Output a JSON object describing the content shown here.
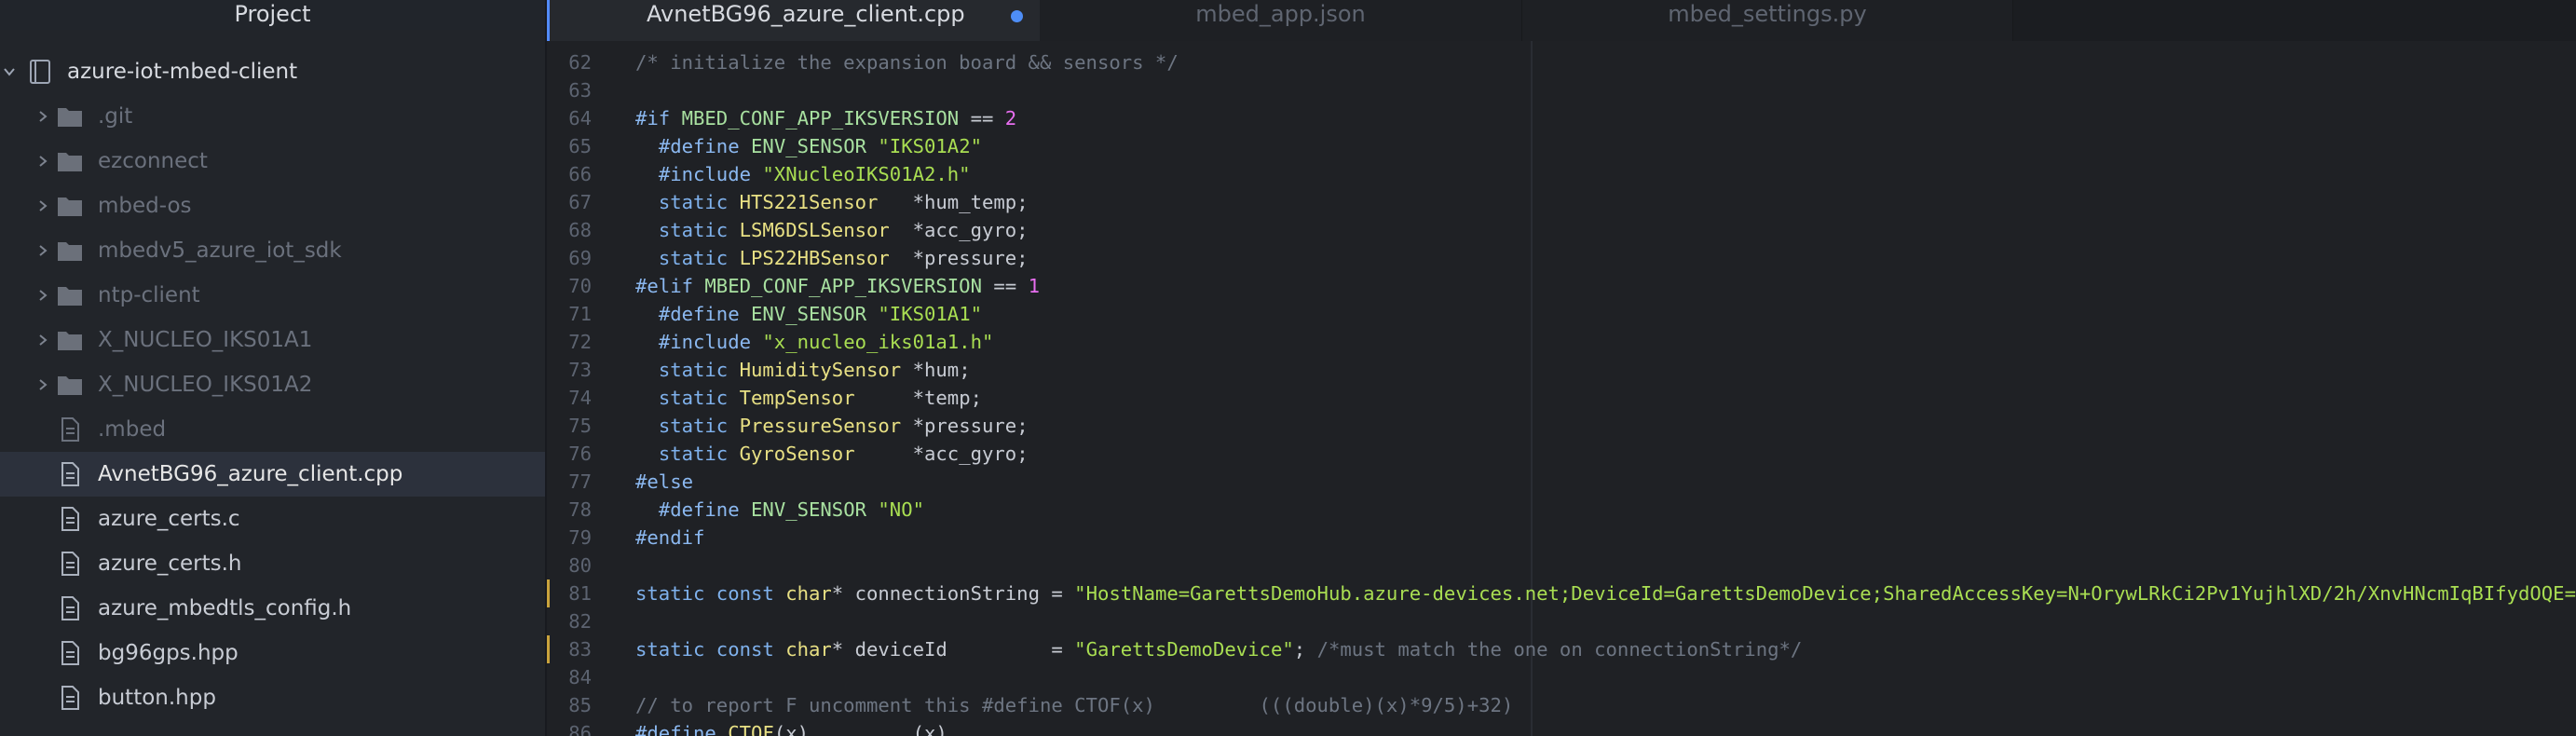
{
  "sidebar": {
    "title": "Project",
    "root": "azure-iot-mbed-client",
    "items": [
      {
        "label": ".git",
        "type": "folder"
      },
      {
        "label": "ezconnect",
        "type": "folder"
      },
      {
        "label": "mbed-os",
        "type": "folder"
      },
      {
        "label": "mbedv5_azure_iot_sdk",
        "type": "folder"
      },
      {
        "label": "ntp-client",
        "type": "folder"
      },
      {
        "label": "X_NUCLEO_IKS01A1",
        "type": "folder"
      },
      {
        "label": "X_NUCLEO_IKS01A2",
        "type": "folder"
      },
      {
        "label": ".mbed",
        "type": "file"
      },
      {
        "label": "AvnetBG96_azure_client.cpp",
        "type": "file",
        "selected": true
      },
      {
        "label": "azure_certs.c",
        "type": "file"
      },
      {
        "label": "azure_certs.h",
        "type": "file"
      },
      {
        "label": "azure_mbedtls_config.h",
        "type": "file"
      },
      {
        "label": "bg96gps.hpp",
        "type": "file"
      },
      {
        "label": "button.hpp",
        "type": "file"
      }
    ]
  },
  "tabs": [
    {
      "label": "AvnetBG96_azure_client.cpp",
      "active": true,
      "modified": true
    },
    {
      "label": "mbed_app.json",
      "active": false
    },
    {
      "label": "mbed_settings.py",
      "active": false
    }
  ],
  "code": {
    "lines": [
      {
        "n": "62",
        "tokens": [
          [
            "c",
            "/* initialize the expansion board && sensors */"
          ]
        ]
      },
      {
        "n": "63",
        "tokens": []
      },
      {
        "n": "64",
        "tokens": [
          [
            "p",
            "#if "
          ],
          [
            "pp",
            "MBED_CONF_APP_IKSVERSION"
          ],
          [
            "w",
            " == "
          ],
          [
            "n",
            "2"
          ]
        ]
      },
      {
        "n": "65",
        "tokens": [
          [
            "w",
            "  "
          ],
          [
            "p",
            "#define "
          ],
          [
            "pp",
            "ENV_SENSOR "
          ],
          [
            "s",
            "\"IKS01A2\""
          ]
        ]
      },
      {
        "n": "66",
        "tokens": [
          [
            "w",
            "  "
          ],
          [
            "p",
            "#include "
          ],
          [
            "s",
            "\"XNucleoIKS01A2.h\""
          ]
        ]
      },
      {
        "n": "67",
        "tokens": [
          [
            "w",
            "  "
          ],
          [
            "k",
            "static "
          ],
          [
            "t",
            "HTS221Sensor"
          ],
          [
            "w",
            "   *hum_temp;"
          ]
        ]
      },
      {
        "n": "68",
        "tokens": [
          [
            "w",
            "  "
          ],
          [
            "k",
            "static "
          ],
          [
            "t",
            "LSM6DSLSensor"
          ],
          [
            "w",
            "  *acc_gyro;"
          ]
        ]
      },
      {
        "n": "69",
        "tokens": [
          [
            "w",
            "  "
          ],
          [
            "k",
            "static "
          ],
          [
            "t",
            "LPS22HBSensor"
          ],
          [
            "w",
            "  *pressure;"
          ]
        ]
      },
      {
        "n": "70",
        "tokens": [
          [
            "p",
            "#elif "
          ],
          [
            "pp",
            "MBED_CONF_APP_IKSVERSION"
          ],
          [
            "w",
            " == "
          ],
          [
            "n",
            "1"
          ]
        ]
      },
      {
        "n": "71",
        "tokens": [
          [
            "w",
            "  "
          ],
          [
            "p",
            "#define "
          ],
          [
            "pp",
            "ENV_SENSOR "
          ],
          [
            "s",
            "\"IKS01A1\""
          ]
        ]
      },
      {
        "n": "72",
        "tokens": [
          [
            "w",
            "  "
          ],
          [
            "p",
            "#include "
          ],
          [
            "s",
            "\"x_nucleo_iks01a1.h\""
          ]
        ]
      },
      {
        "n": "73",
        "tokens": [
          [
            "w",
            "  "
          ],
          [
            "k",
            "static "
          ],
          [
            "t",
            "HumiditySensor"
          ],
          [
            "w",
            " *hum;"
          ]
        ]
      },
      {
        "n": "74",
        "tokens": [
          [
            "w",
            "  "
          ],
          [
            "k",
            "static "
          ],
          [
            "t",
            "TempSensor"
          ],
          [
            "w",
            "     *temp;"
          ]
        ]
      },
      {
        "n": "75",
        "tokens": [
          [
            "w",
            "  "
          ],
          [
            "k",
            "static "
          ],
          [
            "t",
            "PressureSensor"
          ],
          [
            "w",
            " *pressure;"
          ]
        ]
      },
      {
        "n": "76",
        "tokens": [
          [
            "w",
            "  "
          ],
          [
            "k",
            "static "
          ],
          [
            "t",
            "GyroSensor"
          ],
          [
            "w",
            "     *acc_gyro;"
          ]
        ]
      },
      {
        "n": "77",
        "tokens": [
          [
            "p",
            "#else"
          ]
        ]
      },
      {
        "n": "78",
        "tokens": [
          [
            "w",
            "  "
          ],
          [
            "p",
            "#define "
          ],
          [
            "pp",
            "ENV_SENSOR "
          ],
          [
            "s",
            "\"NO\""
          ]
        ]
      },
      {
        "n": "79",
        "tokens": [
          [
            "p",
            "#endif"
          ]
        ]
      },
      {
        "n": "80",
        "tokens": []
      },
      {
        "n": "81",
        "modified": true,
        "tokens": [
          [
            "k",
            "static const "
          ],
          [
            "t",
            "char"
          ],
          [
            "w",
            "* connectionString = "
          ],
          [
            "s",
            "\"HostName=GarettsDemoHub.azure-devices.net;DeviceId=GarettsDemoDevice;SharedAccessKey=N+OrywLRkCi2Pv1YujhlXD/2h/XnvHNcmIqBIfydOQE=\""
          ],
          [
            "w",
            ";"
          ]
        ]
      },
      {
        "n": "82",
        "tokens": []
      },
      {
        "n": "83",
        "modified": true,
        "tokens": [
          [
            "k",
            "static const "
          ],
          [
            "t",
            "char"
          ],
          [
            "w",
            "* deviceId         = "
          ],
          [
            "s",
            "\"GarettsDemoDevice\""
          ],
          [
            "w",
            "; "
          ],
          [
            "c",
            "/*must match the one on connectionString*/"
          ]
        ]
      },
      {
        "n": "84",
        "tokens": []
      },
      {
        "n": "85",
        "tokens": [
          [
            "c",
            "// to report F uncomment this #define CTOF(x)         (((double)(x)*9/5)+32)"
          ]
        ]
      },
      {
        "n": "86",
        "tokens": [
          [
            "p",
            "#define "
          ],
          [
            "t",
            "CTOF"
          ],
          [
            "w",
            "(x)         (x)"
          ]
        ]
      }
    ]
  }
}
